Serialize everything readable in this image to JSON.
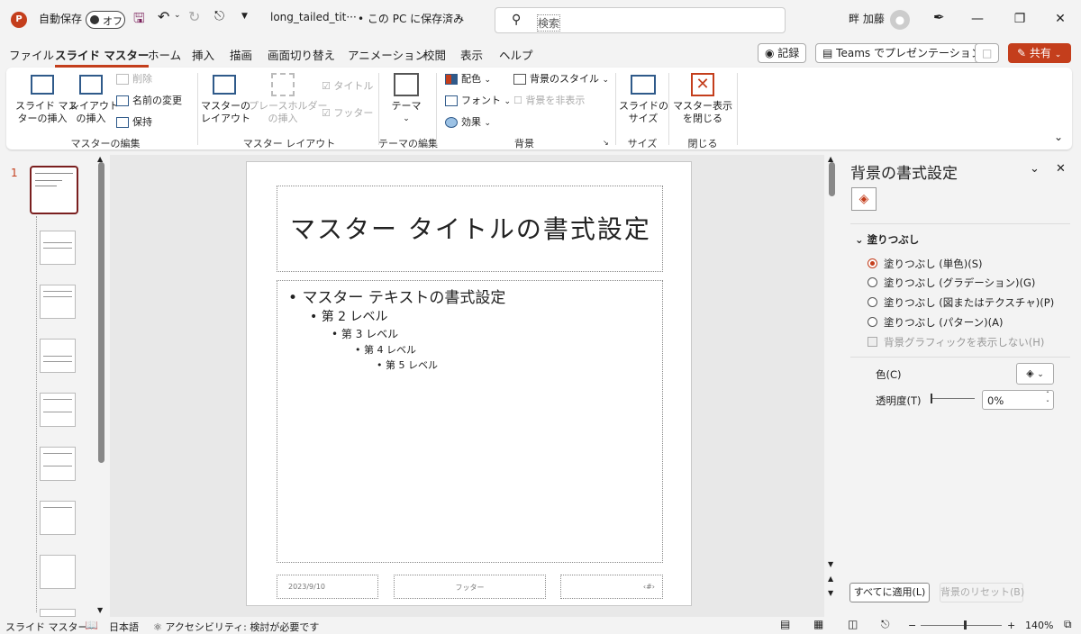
{
  "titlebar": {
    "app_logo": "P",
    "autosave_label": "自動保存",
    "autosave_state": "オフ",
    "filename": "long_tailed_tit···",
    "save_status": "• この PC に保存済み",
    "search_placeholder": "検索",
    "user_name": "畔 加藤"
  },
  "tabs": [
    {
      "label": "ファイル"
    },
    {
      "label": "スライド マスター"
    },
    {
      "label": "ホーム"
    },
    {
      "label": "挿入"
    },
    {
      "label": "描画"
    },
    {
      "label": "画面切り替え"
    },
    {
      "label": "アニメーション"
    },
    {
      "label": "校閲"
    },
    {
      "label": "表示"
    },
    {
      "label": "ヘルプ"
    }
  ],
  "tab_buttons": {
    "record": "記録",
    "teams": "Teams でプレゼンテーション",
    "share": "共有"
  },
  "ribbon": {
    "insert_slide_master": [
      "スライド マス",
      "ターの挿入"
    ],
    "insert_layout": [
      "レイアウト",
      "の挿入"
    ],
    "delete": "削除",
    "rename": "名前の変更",
    "preserve": "保持",
    "group_master_edit": "マスターの編集",
    "master_layout": [
      "マスターの",
      "レイアウト"
    ],
    "insert_placeholder": [
      "プレースホルダー",
      "の挿入"
    ],
    "title_check": "タイトル",
    "footer_check": "フッター",
    "group_master_layout": "マスター レイアウト",
    "theme": "テーマ",
    "group_theme_edit": "テーマの編集",
    "colors": "配色",
    "fonts": "フォント",
    "effects": "効果",
    "bg_styles": "背景のスタイル",
    "hide_bg": "背景を非表示",
    "group_background": "背景",
    "slide_size": [
      "スライドの",
      "サイズ"
    ],
    "group_size": "サイズ",
    "close_master": [
      "マスター表示",
      "を閉じる"
    ],
    "group_close": "閉じる"
  },
  "thumbnails": {
    "first_number": "1"
  },
  "slide": {
    "title": "マスター タイトルの書式設定",
    "level1": "マスター テキストの書式設定",
    "level2": "第 2 レベル",
    "level3": "第 3 レベル",
    "level4": "第 4 レベル",
    "level5": "第 5 レベル",
    "date": "2023/9/10",
    "footer": "フッター",
    "page": "‹#›"
  },
  "format_pane": {
    "title": "背景の書式設定",
    "section": "塗りつぶし",
    "options": [
      {
        "label": "塗りつぶし (単色)(S)",
        "selected": true
      },
      {
        "label": "塗りつぶし (グラデーション)(G)",
        "selected": false
      },
      {
        "label": "塗りつぶし (図またはテクスチャ)(P)",
        "selected": false
      },
      {
        "label": "塗りつぶし (パターン)(A)",
        "selected": false
      }
    ],
    "hide_bg_graphics": "背景グラフィックを表示しない(H)",
    "color_label": "色(C)",
    "transparency_label": "透明度(T)",
    "transparency_value": "0%",
    "apply_all": "すべてに適用(L)",
    "reset_bg": "背景のリセット(B)"
  },
  "statusbar": {
    "view": "スライド マスター",
    "language": "日本語",
    "accessibility": "アクセシビリティ: 検討が必要です",
    "zoom": "140%"
  },
  "colors": {
    "accent": "#c43e1c",
    "selected_thumb": "#7a1f1f"
  }
}
